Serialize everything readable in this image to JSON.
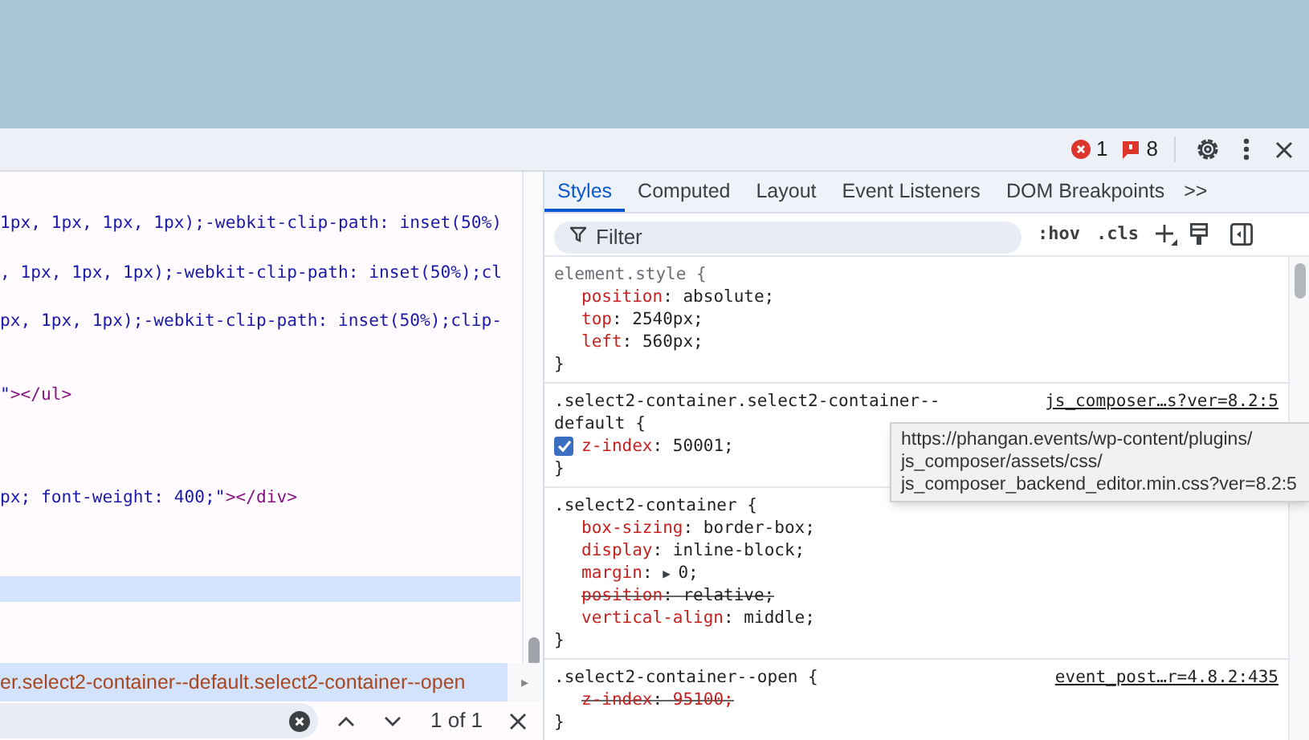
{
  "toolbar": {
    "errors": "1",
    "issues": "8"
  },
  "elements": {
    "lines": [
      {
        "selected": false,
        "segments": [
          {
            "kind": "value",
            "text": "1px, 1px, 1px, 1px);-webkit-clip-path: inset(50%)"
          }
        ]
      },
      {
        "selected": false,
        "segments": [
          {
            "kind": "value",
            "text": ", 1px, 1px, 1px);-webkit-clip-path: inset(50%);cl"
          }
        ]
      },
      {
        "selected": false,
        "segments": [
          {
            "kind": "value",
            "text": "px, 1px, 1px);-webkit-clip-path: inset(50%);clip-"
          }
        ]
      },
      {
        "selected": false,
        "segments": [
          {
            "kind": "value",
            "text": "\""
          },
          {
            "kind": "tag",
            "text": "></ul>"
          }
        ]
      },
      {
        "selected": false,
        "segments": [
          {
            "kind": "value",
            "text": "px; font-weight: 400;\""
          },
          {
            "kind": "tag",
            "text": "></div>"
          }
        ]
      },
      {
        "selected": true
      }
    ],
    "breadcrumb": "er.select2-container--default.select2-container--open",
    "breadcrumb_scroll": "▸",
    "search": {
      "match_count": "1 of 1"
    }
  },
  "styles": {
    "tabs": [
      {
        "label": "Styles",
        "selected": true
      },
      {
        "label": "Computed",
        "selected": false
      },
      {
        "label": "Layout",
        "selected": false
      },
      {
        "label": "Event Listeners",
        "selected": false
      },
      {
        "label": "DOM Breakpoints",
        "selected": false
      }
    ],
    "more_tabs": ">>",
    "filter": {
      "placeholder": "Filter"
    },
    "hov": ":hov",
    "cls": ".cls",
    "rules": [
      {
        "kind": "inline",
        "selector": "element.style {",
        "props": [
          {
            "name": "position",
            "sep": ":",
            "value": "absolute;",
            "struck": false
          },
          {
            "name": "top",
            "sep": ":",
            "value": "2540px;",
            "struck": false
          },
          {
            "name": "left",
            "sep": ":",
            "value": "560px;",
            "struck": false
          }
        ],
        "close": "}"
      },
      {
        "kind": "rule",
        "selector": ".select2-container.select2-container--",
        "selector_2": "default {",
        "source": "js_composer…s?ver=8.2:5",
        "props": [
          {
            "name": "z-index",
            "sep": ":",
            "value": "50001;",
            "struck": false,
            "checked": true
          }
        ],
        "close": "}"
      },
      {
        "kind": "rule",
        "selector": ".select2-container {",
        "props": [
          {
            "name": "box-sizing",
            "sep": ":",
            "value": "border-box;",
            "struck": false
          },
          {
            "name": "display",
            "sep": ":",
            "value": "inline-block;",
            "struck": false
          },
          {
            "name": "margin",
            "sep": ":",
            "expander": "▶",
            "value": "0;",
            "struck": false
          },
          {
            "name": "position",
            "sep": ":",
            "value": "relative;",
            "struck": true
          },
          {
            "name": "vertical-align",
            "sep": ":",
            "value": "middle;",
            "struck": false
          }
        ],
        "close": "}"
      },
      {
        "kind": "rule",
        "selector": ".select2-container--open {",
        "source": "event_post…r=4.8.2:435",
        "props": [
          {
            "name": "z-index",
            "sep": ":",
            "value": "95100;",
            "struck": true
          }
        ],
        "close": "}"
      }
    ],
    "tooltip": [
      "https://phangan.events/wp-content/plugins/",
      "js_composer/assets/css/",
      "js_composer_backend_editor.min.css?ver=8.2:5"
    ]
  }
}
